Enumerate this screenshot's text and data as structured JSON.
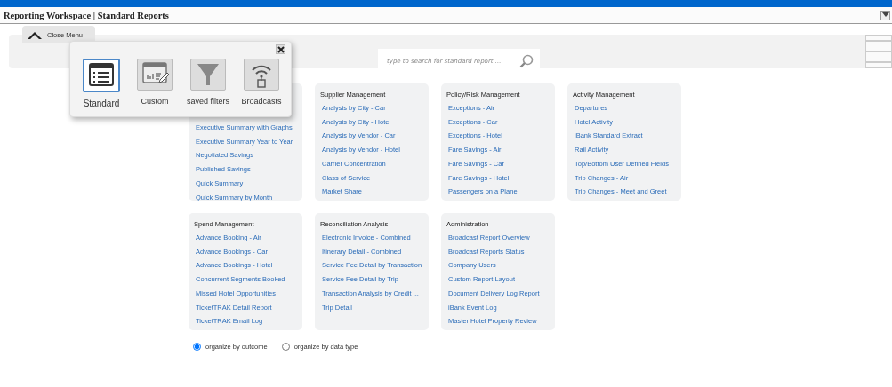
{
  "window": {
    "title": "Reporting Workspace | Standard Reports"
  },
  "menu_tab": {
    "label": "Close Menu"
  },
  "menu_popup": {
    "items": [
      {
        "kind": "standard",
        "label": "Standard",
        "selected": true
      },
      {
        "kind": "custom",
        "label": "Custom",
        "selected": false
      },
      {
        "kind": "filter",
        "label": "saved filters",
        "selected": false
      },
      {
        "kind": "broadcast",
        "label": "Broadcasts",
        "selected": false
      }
    ]
  },
  "search": {
    "placeholder": "type to search for standard report ..."
  },
  "cards": [
    {
      "items": [
        "Executive Summary with Graphs",
        "Executive Summary Year to Year",
        "Negotiated Savings",
        "Published Savings",
        "Quick Summary",
        "Quick Summary by Month"
      ]
    },
    {
      "title": "Supplier Management",
      "items": [
        "Analysis by City - Car",
        "Analysis by City - Hotel",
        "Analysis by Vendor - Car",
        "Analysis by Vendor - Hotel",
        "Carrier Concentration",
        "Class of Service",
        "Market Share"
      ]
    },
    {
      "title": "Policy/Risk Management",
      "items": [
        "Exceptions - Air",
        "Exceptions - Car",
        "Exceptions - Hotel",
        "Fare Savings - Air",
        "Fare Savings - Car",
        "Fare Savings - Hotel",
        "Passengers on a Plane"
      ]
    },
    {
      "title": "Activity Management",
      "items": [
        "Departures",
        "Hotel Activity",
        "iBank Standard Extract",
        "Rail Activity",
        "Top/Bottom User Defined Fields",
        "Trip Changes - Air",
        "Trip Changes - Meet and Greet"
      ]
    },
    {
      "title": "Spend Management",
      "items": [
        "Advance Booking - Air",
        "Advance Bookings - Car",
        "Advance Bookings - Hotel",
        "Concurrent Segments Booked",
        "Missed Hotel Opportunities",
        "TicketTRAK Detail Report",
        "TicketTRAK Email Log"
      ]
    },
    {
      "title": "Reconciliation Analysis",
      "items": [
        "Electronic Invoice - Combined",
        "Itinerary Detail - Combined",
        "Service Fee Detail by Transaction",
        "Service Fee Detail by Trip",
        "Transaction Analysis by Credit ...",
        "Trip Detail"
      ]
    },
    {
      "title": "Administration",
      "items": [
        "Broadcast Report Overview",
        "Broadcast Reports Status",
        "Company Users",
        "Custom Report Layout",
        "Document Delivery Log Report",
        "iBank Event Log",
        "Master Hotel Property Review"
      ]
    }
  ],
  "organize": [
    {
      "label": "organize by outcome",
      "selected": true
    },
    {
      "label": "organize by data type",
      "selected": false
    }
  ]
}
